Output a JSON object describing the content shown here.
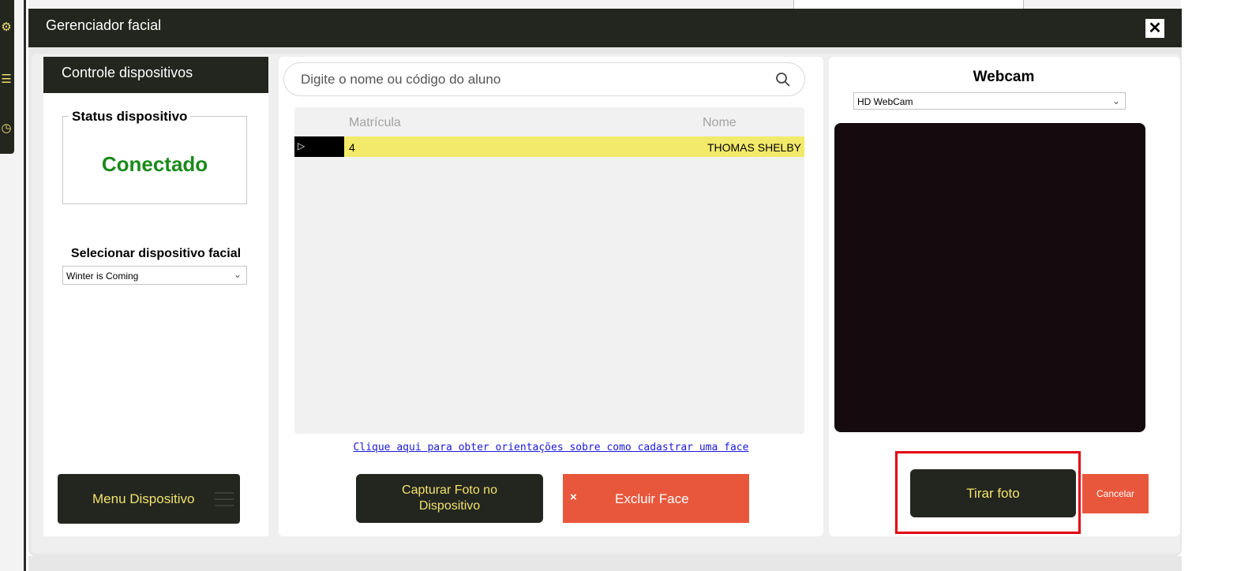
{
  "dialog": {
    "title": "Gerenciador facial",
    "close_label": "✕"
  },
  "left_panel": {
    "header": "Controle dispositivos",
    "status_legend": "Status dispositivo",
    "status_value": "Conectado",
    "select_label": "Selecionar dispositivo facial",
    "device_selected": "Winter is Coming",
    "menu_button": "Menu Dispositivo"
  },
  "search": {
    "placeholder": "Digite o nome ou código do aluno"
  },
  "grid": {
    "columns": [
      "Matrícula",
      "Nome"
    ],
    "rows": [
      {
        "indicator": "▷",
        "matricula": "4",
        "nome": "THOMAS SHELBY"
      }
    ]
  },
  "help_link": "Clique aqui para obter orientações sobre como cadastrar uma face",
  "actions": {
    "capture_line1": "Capturar Foto no",
    "capture_line2": "Dispositivo",
    "delete_icon": "×",
    "delete_label": "Excluir Face"
  },
  "webcam": {
    "title": "Webcam",
    "device_selected": "HD WebCam",
    "take_photo": "Tirar foto",
    "cancel": "Cancelar"
  },
  "colors": {
    "dark": "#23251f",
    "accent_yellow": "#f1e36b",
    "row_highlight": "#f3e96a",
    "danger": "#e8573c",
    "status_green": "#1a8a1a",
    "annotation_red": "#e3000f"
  }
}
